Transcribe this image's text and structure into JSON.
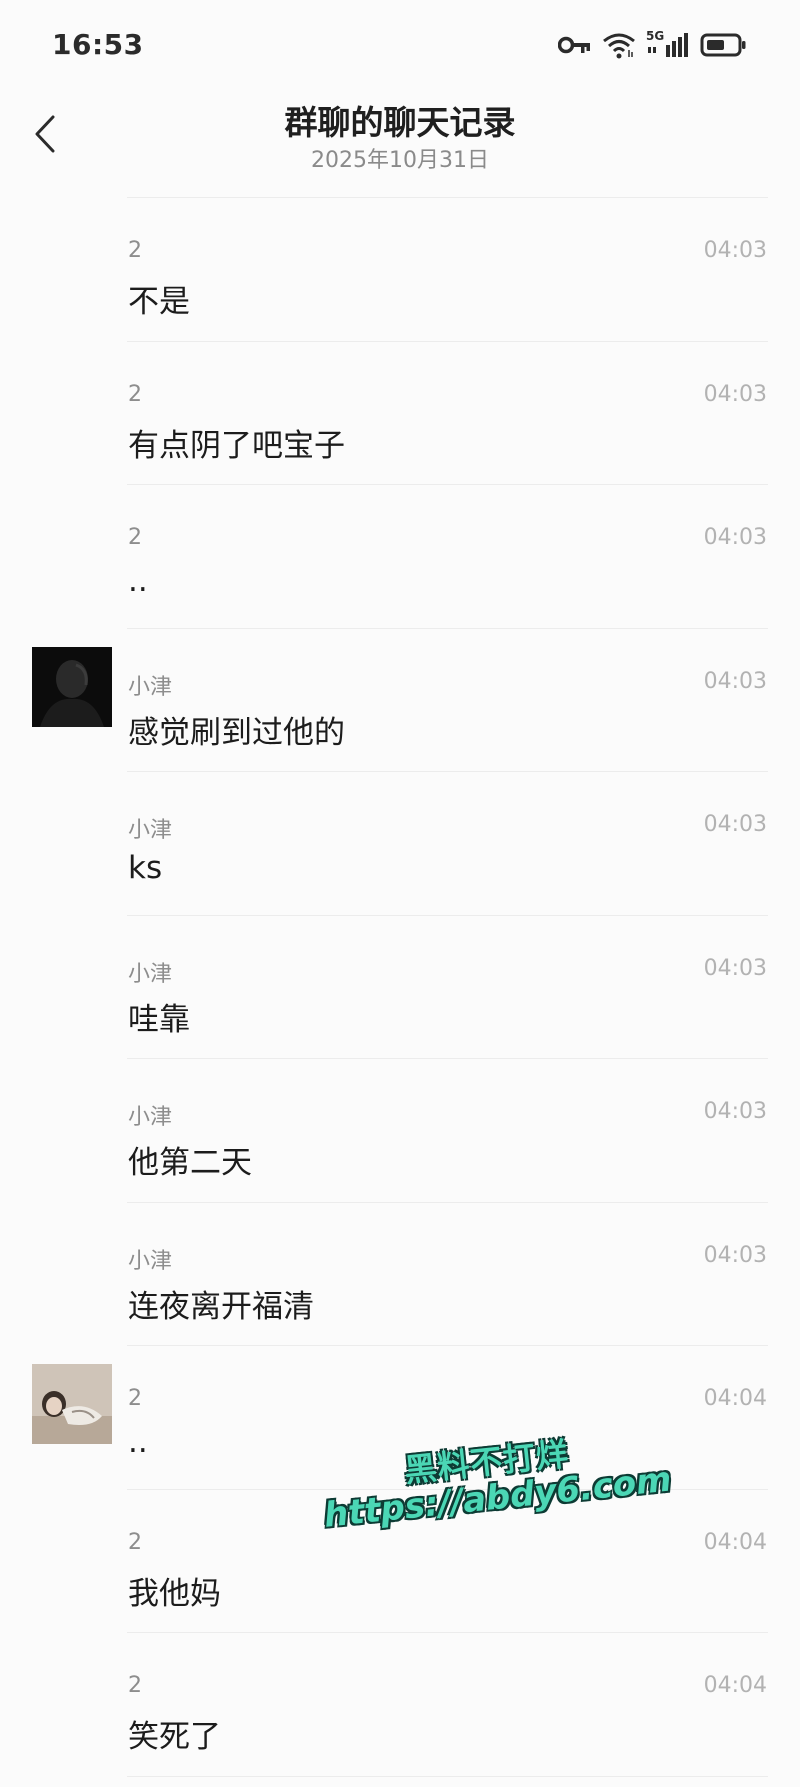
{
  "status_bar": {
    "time": "16:53",
    "network_label": "5G",
    "icons": [
      "key-icon",
      "wifi-icon",
      "signal-icon",
      "battery-icon"
    ],
    "battery_level": 0.6
  },
  "header": {
    "title": "群聊的聊天记录",
    "subtitle": "2025年10月31日",
    "back_icon": "chevron-left-icon"
  },
  "messages": [
    {
      "sender": "2",
      "time": "04:03",
      "text": "不是",
      "avatar": false
    },
    {
      "sender": "2",
      "time": "04:03",
      "text": "有点阴了吧宝子",
      "avatar": false
    },
    {
      "sender": "2",
      "time": "04:03",
      "text": "..",
      "avatar": false
    },
    {
      "sender": "小津",
      "time": "04:03",
      "text": "感觉刷到过他的",
      "avatar": true
    },
    {
      "sender": "小津",
      "time": "04:03",
      "text": "ks",
      "avatar": false
    },
    {
      "sender": "小津",
      "time": "04:03",
      "text": "哇靠",
      "avatar": false
    },
    {
      "sender": "小津",
      "time": "04:03",
      "text": "他第二天",
      "avatar": false
    },
    {
      "sender": "小津",
      "time": "04:03",
      "text": "连夜离开福清",
      "avatar": false
    },
    {
      "sender": "2",
      "time": "04:04",
      "text": "..",
      "avatar": true
    },
    {
      "sender": "2",
      "time": "04:04",
      "text": "我他妈",
      "avatar": false
    },
    {
      "sender": "2",
      "time": "04:04",
      "text": "笑死了",
      "avatar": false
    }
  ],
  "watermark": {
    "line1": "黑料不打烊",
    "line2": "https://abdy6.com"
  },
  "colors": {
    "background": "#fbfbfb",
    "watermark": "#4bd7b5",
    "watermark_outline": "#0d3b34"
  }
}
